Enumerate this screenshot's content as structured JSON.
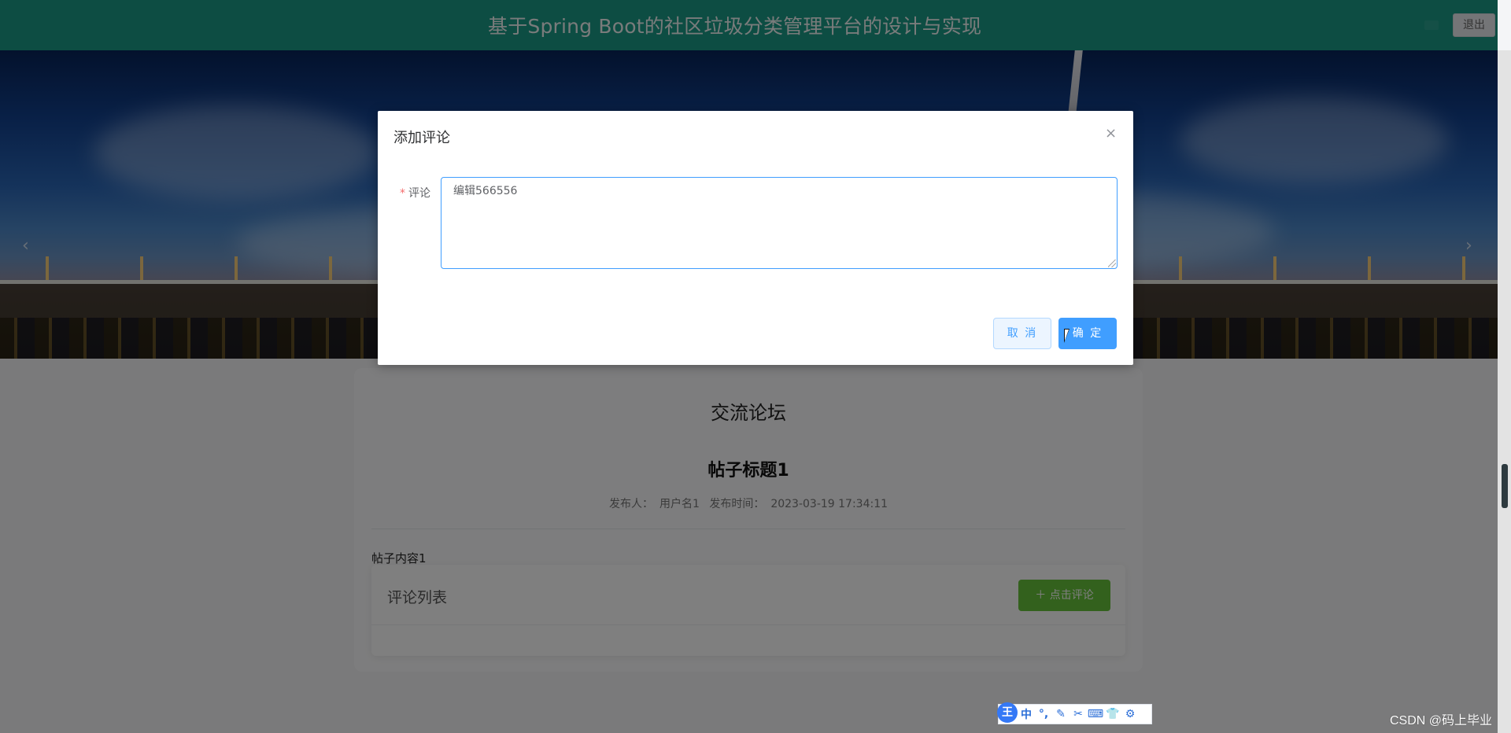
{
  "header": {
    "title": "基于Spring Boot的社区垃圾分类管理平台的设计与实现",
    "logout_label": "退出"
  },
  "carousel": {
    "prev_arrow": "‹",
    "next_arrow": "›"
  },
  "forum": {
    "heading": "交流论坛",
    "post_title": "帖子标题1",
    "publisher_label": "发布人：",
    "publisher": "用户名1",
    "time_label": "发布时间：",
    "time": "2023-03-19 17:34:11",
    "content": "帖子内容1",
    "comment_list_label": "评论列表",
    "add_comment_label": "＋ 点击评论"
  },
  "dialog": {
    "title": "添加评论",
    "close_symbol": "×",
    "field_required_mark": "*",
    "field_label": "评论",
    "comment_value": "编辑566556",
    "cancel_label": "取 消",
    "confirm_label": "确 定"
  },
  "ime_toolbar": {
    "logo": "王",
    "items": [
      "中",
      "°,",
      "✎",
      "✂",
      "⌨",
      "👕",
      "⚙"
    ]
  },
  "watermark": "CSDN @码上毕业",
  "colors": {
    "header": "#1a9a86",
    "primary": "#409eff",
    "success": "#67c23a",
    "required": "#f56c6c"
  }
}
